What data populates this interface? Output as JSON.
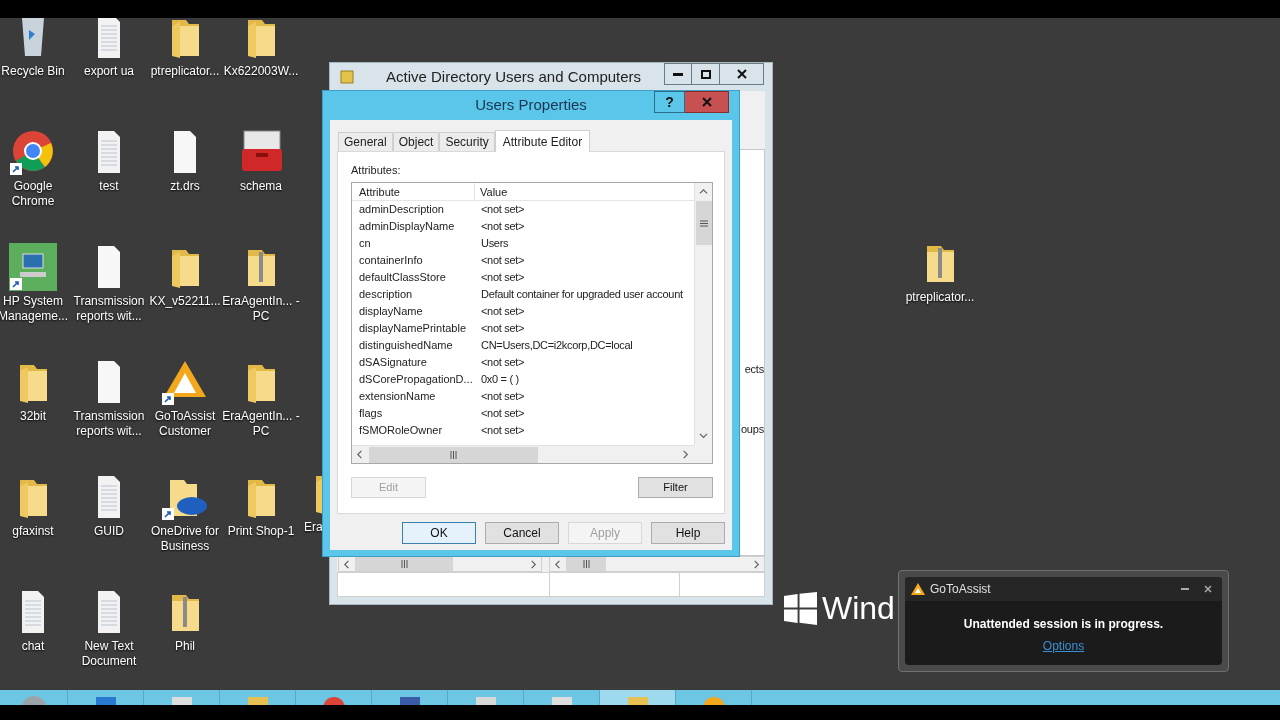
{
  "desktop_icons": [
    {
      "label": "Recycle Bin",
      "kind": "recycle",
      "shortcut": false
    },
    {
      "label": "export ua",
      "kind": "text",
      "shortcut": false
    },
    {
      "label": "ptreplicator...",
      "kind": "folder",
      "shortcut": false
    },
    {
      "label": "Kx622003W...",
      "kind": "folder",
      "shortcut": false
    },
    {
      "label": "Google Chrome",
      "kind": "chrome",
      "shortcut": true
    },
    {
      "label": "test",
      "kind": "text",
      "shortcut": false
    },
    {
      "label": "zt.drs",
      "kind": "file",
      "shortcut": false
    },
    {
      "label": "schema",
      "kind": "toolbox",
      "shortcut": false
    },
    {
      "label": "HP System Manageme...",
      "kind": "hp",
      "shortcut": true
    },
    {
      "label": "Transmission reports wit...",
      "kind": "file",
      "shortcut": false
    },
    {
      "label": "KX_v52211...",
      "kind": "folder",
      "shortcut": false
    },
    {
      "label": "EraAgentIn... - PC",
      "kind": "zip",
      "shortcut": false
    },
    {
      "label": "32bit",
      "kind": "folder",
      "shortcut": false
    },
    {
      "label": "Transmission reports wit...",
      "kind": "file",
      "shortcut": false
    },
    {
      "label": "GoToAssist Customer",
      "kind": "gotoassist",
      "shortcut": true
    },
    {
      "label": "EraAgentIn... - PC",
      "kind": "folder",
      "shortcut": false
    },
    {
      "label": "gfaxinst",
      "kind": "folder",
      "shortcut": false
    },
    {
      "label": "GUID",
      "kind": "text",
      "shortcut": false
    },
    {
      "label": "OneDrive for Business",
      "kind": "onedrive",
      "shortcut": true
    },
    {
      "label": "Print Shop-1",
      "kind": "folder",
      "shortcut": false
    },
    {
      "label": "chat",
      "kind": "text",
      "shortcut": false
    },
    {
      "label": "New Text Document",
      "kind": "text",
      "shortcut": false
    },
    {
      "label": "Phil",
      "kind": "zip",
      "shortcut": false
    }
  ],
  "partial_icon": {
    "label": "Era",
    "kind": "folder"
  },
  "right_icon": {
    "label": "ptreplicator...",
    "kind": "zip"
  },
  "aduc_window": {
    "title": "Active Directory Users and Computers",
    "side_labels": [
      "ects",
      "oups"
    ]
  },
  "dialog": {
    "title": "Users Properties",
    "help": "?",
    "tabs": [
      {
        "label": "General",
        "selected": false
      },
      {
        "label": "Object",
        "selected": false
      },
      {
        "label": "Security",
        "selected": false
      },
      {
        "label": "Attribute Editor",
        "selected": true
      }
    ],
    "attributes_label": "Attributes:",
    "columns": [
      "Attribute",
      "Value"
    ],
    "rows": [
      {
        "attribute": "adminDescription",
        "value": "<not set>"
      },
      {
        "attribute": "adminDisplayName",
        "value": "<not set>"
      },
      {
        "attribute": "cn",
        "value": "Users"
      },
      {
        "attribute": "containerInfo",
        "value": "<not set>"
      },
      {
        "attribute": "defaultClassStore",
        "value": "<not set>"
      },
      {
        "attribute": "description",
        "value": "Default container for upgraded user account"
      },
      {
        "attribute": "displayName",
        "value": "<not set>"
      },
      {
        "attribute": "displayNamePrintable",
        "value": "<not set>"
      },
      {
        "attribute": "distinguishedName",
        "value": "CN=Users,DC=i2kcorp,DC=local"
      },
      {
        "attribute": "dSASignature",
        "value": "<not set>"
      },
      {
        "attribute": "dSCorePropagationD...",
        "value": "0x0 = ( )"
      },
      {
        "attribute": "extensionName",
        "value": "<not set>"
      },
      {
        "attribute": "flags",
        "value": "<not set>"
      },
      {
        "attribute": "fSMORoleOwner",
        "value": "<not set>"
      }
    ],
    "edit_button": {
      "label": "Edit",
      "disabled": true
    },
    "filter_button": {
      "label": "Filter",
      "disabled": false
    },
    "buttons": [
      {
        "label": "OK",
        "disabled": false,
        "default": true
      },
      {
        "label": "Cancel",
        "disabled": false,
        "default": false
      },
      {
        "label": "Apply",
        "disabled": true,
        "default": false
      },
      {
        "label": "Help",
        "disabled": false,
        "default": false
      }
    ]
  },
  "windows_logo": {
    "text": "Wind"
  },
  "notification": {
    "app": "GoToAssist",
    "message": "Unattended session is in progress.",
    "link": "Options"
  },
  "taskbar": [
    {
      "kind": "start",
      "selected": false
    },
    {
      "kind": "server",
      "selected": false
    },
    {
      "kind": "terminal",
      "selected": false
    },
    {
      "kind": "folder",
      "selected": false
    },
    {
      "kind": "chrome",
      "selected": false
    },
    {
      "kind": "network",
      "selected": false
    },
    {
      "kind": "window",
      "selected": false
    },
    {
      "kind": "terminal",
      "selected": false
    },
    {
      "kind": "folder",
      "selected": true
    },
    {
      "kind": "gotoassist",
      "selected": false
    }
  ]
}
